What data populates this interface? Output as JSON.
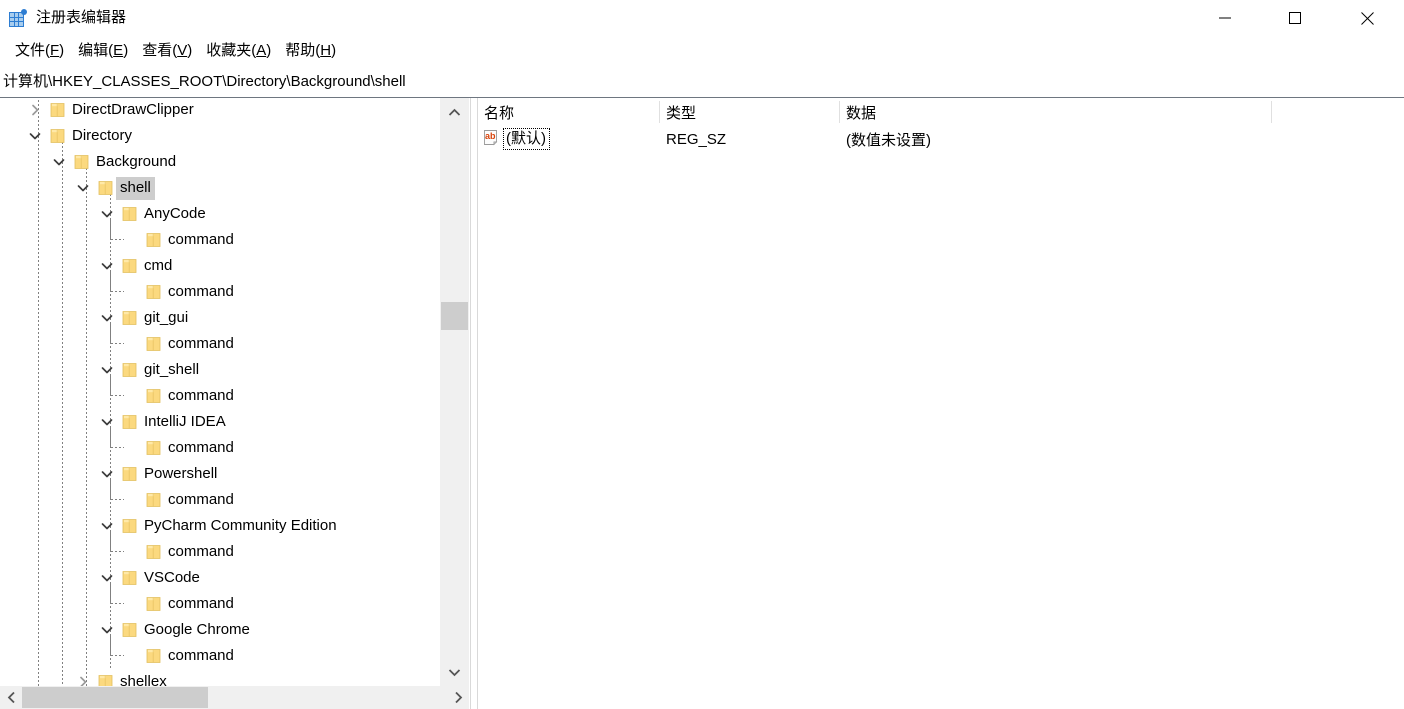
{
  "window": {
    "title": "注册表编辑器",
    "icon": "registry-editor-icon",
    "minimize_label": "最小化",
    "maximize_label": "最大化",
    "close_label": "关闭"
  },
  "menubar": {
    "items": [
      {
        "label": "文件(F)",
        "text": "文件(",
        "accel": "F",
        "tail": ")"
      },
      {
        "label": "编辑(E)",
        "text": "编辑(",
        "accel": "E",
        "tail": ")"
      },
      {
        "label": "查看(V)",
        "text": "查看(",
        "accel": "V",
        "tail": ")"
      },
      {
        "label": "收藏夹(A)",
        "text": "收藏夹(",
        "accel": "A",
        "tail": ")"
      },
      {
        "label": "帮助(H)",
        "text": "帮助(",
        "accel": "H",
        "tail": ")"
      }
    ]
  },
  "address": {
    "path": "计算机\\HKEY_CLASSES_ROOT\\Directory\\Background\\shell"
  },
  "tree": {
    "nodes": [
      {
        "label": "DirectDrawClipper",
        "depth": 1,
        "state": "collapsed",
        "selected": false,
        "clipped_top": true
      },
      {
        "label": "Directory",
        "depth": 1,
        "state": "expanded",
        "selected": false
      },
      {
        "label": "Background",
        "depth": 2,
        "state": "expanded",
        "selected": false
      },
      {
        "label": "shell",
        "depth": 3,
        "state": "expanded",
        "selected": true
      },
      {
        "label": "AnyCode",
        "depth": 4,
        "state": "expanded",
        "selected": false
      },
      {
        "label": "command",
        "depth": 5,
        "state": "leaf",
        "selected": false
      },
      {
        "label": "cmd",
        "depth": 4,
        "state": "expanded",
        "selected": false
      },
      {
        "label": "command",
        "depth": 5,
        "state": "leaf",
        "selected": false
      },
      {
        "label": "git_gui",
        "depth": 4,
        "state": "expanded",
        "selected": false
      },
      {
        "label": "command",
        "depth": 5,
        "state": "leaf",
        "selected": false
      },
      {
        "label": "git_shell",
        "depth": 4,
        "state": "expanded",
        "selected": false
      },
      {
        "label": "command",
        "depth": 5,
        "state": "leaf",
        "selected": false
      },
      {
        "label": "IntelliJ IDEA",
        "depth": 4,
        "state": "expanded",
        "selected": false
      },
      {
        "label": "command",
        "depth": 5,
        "state": "leaf",
        "selected": false
      },
      {
        "label": "Powershell",
        "depth": 4,
        "state": "expanded",
        "selected": false
      },
      {
        "label": "command",
        "depth": 5,
        "state": "leaf",
        "selected": false
      },
      {
        "label": "PyCharm Community Edition",
        "depth": 4,
        "state": "expanded",
        "selected": false
      },
      {
        "label": "command",
        "depth": 5,
        "state": "leaf",
        "selected": false
      },
      {
        "label": "VSCode",
        "depth": 4,
        "state": "expanded",
        "selected": false
      },
      {
        "label": "command",
        "depth": 5,
        "state": "leaf",
        "selected": false
      },
      {
        "label": "Google Chrome",
        "depth": 4,
        "state": "expanded",
        "selected": false
      },
      {
        "label": "command",
        "depth": 5,
        "state": "leaf",
        "selected": false
      },
      {
        "label": "shellex",
        "depth": 3,
        "state": "collapsed",
        "selected": false,
        "clipped_bottom": true
      }
    ]
  },
  "listview": {
    "columns": [
      {
        "key": "name",
        "label": "名称"
      },
      {
        "key": "type",
        "label": "类型"
      },
      {
        "key": "data",
        "label": "数据"
      }
    ],
    "rows": [
      {
        "name": "(默认)",
        "type": "REG_SZ",
        "data": "(数值未设置)",
        "icon": "string-value-icon",
        "focused": true
      }
    ]
  },
  "scrollbars": {
    "vertical": {
      "up_icon": "chevron-up-icon",
      "down_icon": "chevron-down-icon",
      "thumb_top_pct": 33
    },
    "horizontal": {
      "left_icon": "chevron-left-icon",
      "right_icon": "chevron-right-icon",
      "thumb_left_pct": 0
    }
  },
  "colors": {
    "folder": "#fbd97f",
    "folder_tab": "#ffe9a8",
    "selection": "#cdcdcd",
    "scroll_track": "#f0f0f0",
    "scroll_thumb": "#cdcdcd",
    "accent": "#2d7dd2",
    "divider": "#6e7680"
  }
}
